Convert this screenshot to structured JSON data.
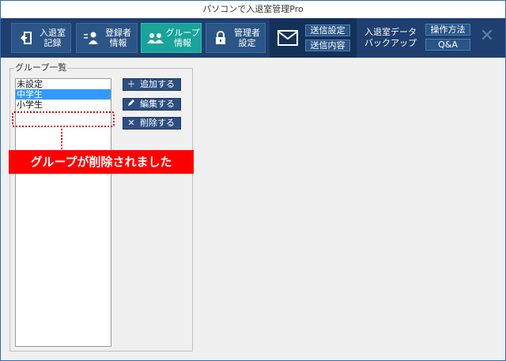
{
  "window": {
    "title": "パソコンで入退室管理Pro"
  },
  "toolbar": {
    "entry_exit_log": "入退室\n記録",
    "registrant_info": "登録者\n情報",
    "group_info": "グループ\n情報",
    "admin_settings": "管理者\n設定",
    "send_settings": "送信設定",
    "send_content": "送信内容",
    "backup": "入退室データ\nバックアップ",
    "how_to_use": "操作方法",
    "faq": "Q&A",
    "close": "✕"
  },
  "group_panel": {
    "title": "グループ一覧",
    "items": [
      {
        "label": "未設定",
        "selected": false
      },
      {
        "label": "中学生",
        "selected": true
      },
      {
        "label": "小学生",
        "selected": false
      }
    ],
    "add_button": "追加する",
    "edit_button": "編集する",
    "delete_button": "削除する"
  },
  "annotation": {
    "message": "グループが削除されました"
  },
  "colors": {
    "toolbar_bg": "#1e3f6f",
    "active_tab": "#19a39a",
    "selection": "#3399ff",
    "alert": "#ff0000"
  }
}
